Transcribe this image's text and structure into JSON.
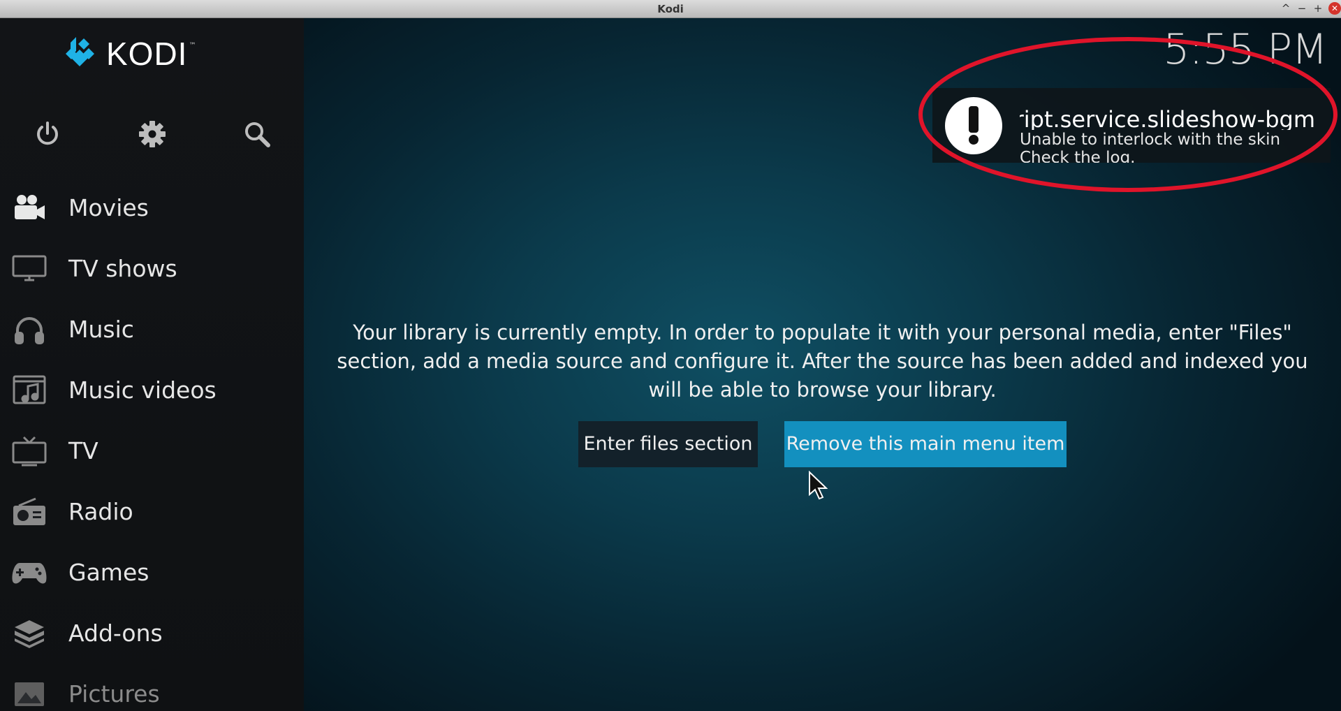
{
  "window": {
    "title": "Kodi"
  },
  "brand": {
    "logo_text": "KODI",
    "tm": "™",
    "accent": "#1fb2e6"
  },
  "header": {
    "clock": "5:55 PM"
  },
  "sidebar": {
    "top_icons": [
      {
        "name": "power-icon"
      },
      {
        "name": "settings-icon"
      },
      {
        "name": "search-icon"
      }
    ],
    "items": [
      {
        "label": "Movies",
        "icon": "movie-camera-icon"
      },
      {
        "label": "TV shows",
        "icon": "tv-monitor-icon"
      },
      {
        "label": "Music",
        "icon": "headphones-icon"
      },
      {
        "label": "Music videos",
        "icon": "music-video-icon"
      },
      {
        "label": "TV",
        "icon": "live-tv-icon"
      },
      {
        "label": "Radio",
        "icon": "radio-icon"
      },
      {
        "label": "Games",
        "icon": "gamepad-icon"
      },
      {
        "label": "Add-ons",
        "icon": "addons-box-icon"
      },
      {
        "label": "Pictures",
        "icon": "pictures-icon"
      }
    ]
  },
  "notification": {
    "title": "script.service.slideshow-bgm",
    "line1": "Unable to interlock with the skin",
    "line2": "Check the log.",
    "icon": "exclamation-icon",
    "highlight_color": "#e0142a"
  },
  "main": {
    "message": "Your library is currently empty. In order to populate it with your personal media, enter \"Files\" section, add a media source and configure it. After the source has been added and indexed you will be able to browse your library.",
    "enter_files_button": "Enter files section",
    "remove_item_button": "Remove this main menu item",
    "accent_button_color": "#1390bf"
  }
}
